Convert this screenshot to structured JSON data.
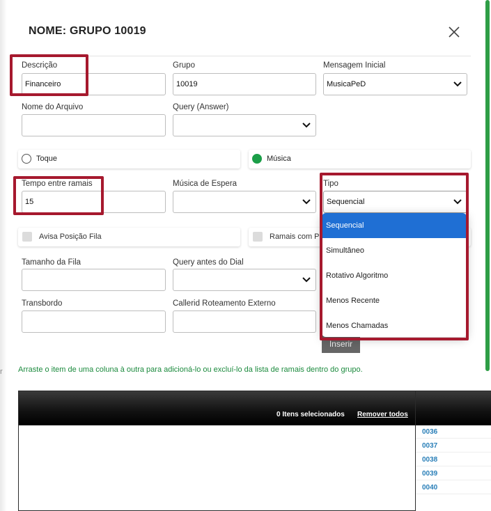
{
  "dialog": {
    "title": "NOME: GRUPO 10019"
  },
  "form": {
    "descricao": {
      "label": "Descrição",
      "value": "Financeiro"
    },
    "grupo": {
      "label": "Grupo",
      "value": "10019"
    },
    "mensagem_inicial": {
      "label": "Mensagem Inicial",
      "value": "MusicaPeD"
    },
    "nome_arquivo": {
      "label": "Nome do Arquivo",
      "value": ""
    },
    "query_answer": {
      "label": "Query (Answer)",
      "value": ""
    },
    "toque": {
      "label": "Toque",
      "selected": false
    },
    "musica": {
      "label": "Música",
      "selected": true
    },
    "tempo_entre_ramais": {
      "label": "Tempo entre ramais",
      "value": "15"
    },
    "musica_espera": {
      "label": "Música de Espera",
      "value": ""
    },
    "tipo": {
      "label": "Tipo",
      "value": "Sequencial"
    },
    "avisa_posicao_fila": {
      "label": "Avisa Posição Fila",
      "checked": false
    },
    "ramais_com": {
      "label": "Ramais com P",
      "checked": false
    },
    "tamanho_fila": {
      "label": "Tamanho da Fila",
      "value": ""
    },
    "query_antes_dial": {
      "label": "Query antes do Dial",
      "value": ""
    },
    "transbordo": {
      "label": "Transbordo",
      "value": ""
    },
    "callerid": {
      "label": "Callerid Roteamento Externo",
      "value": ""
    }
  },
  "tipo_dropdown": {
    "options": [
      "Sequencial",
      "Simultâneo",
      "Rotativo Algoritmo",
      "Menos Recente",
      "Menos Chamadas"
    ],
    "selected_index": 0
  },
  "insert_button": "Inserir",
  "hint_text": "Arraste o item de uma coluna à  outra para adicioná-lo ou excluí-lo da lista de ramais dentro do grupo.",
  "selected_panel": {
    "count_label": "0 Itens selecionados",
    "remove_all_label": "Remover todos"
  },
  "available_items": [
    "0036",
    "0037",
    "0038",
    "0039",
    "0040"
  ],
  "outside_text": "r",
  "colors": {
    "highlight": "#a6192e",
    "accent_green": "#1b9e48",
    "dropdown_selected": "#1f6fd4",
    "link_blue": "#2a7fb8",
    "hint_green": "#1b8a3d"
  }
}
